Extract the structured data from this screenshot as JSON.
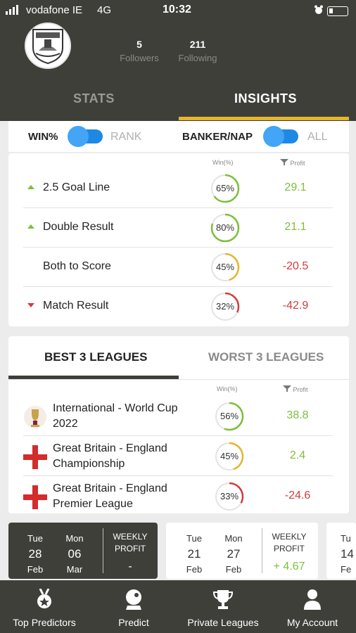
{
  "status_bar": {
    "carrier": "vodafone IE",
    "network": "4G",
    "time": "10:32"
  },
  "profile": {
    "followers_count": "5",
    "followers_label": "Followers",
    "following_count": "211",
    "following_label": "Following"
  },
  "tabs": [
    {
      "label": "STATS"
    },
    {
      "label": "INSIGHTS"
    }
  ],
  "toggles": {
    "win_label": "WIN%",
    "rank_label": "RANK",
    "banker_label": "BANKER/NAP",
    "all_label": "ALL"
  },
  "markets": {
    "col_win": "Win(%)",
    "col_profit": "Profit",
    "rows": [
      {
        "name": "2.5 Goal Line",
        "trend": "up",
        "win_pct": "65%",
        "win_value": 65,
        "profit": "29.1"
      },
      {
        "name": "Double Result",
        "trend": "up",
        "win_pct": "80%",
        "win_value": 80,
        "profit": "21.1"
      },
      {
        "name": "Both to Score",
        "trend": "none",
        "win_pct": "45%",
        "win_value": 45,
        "profit": "-20.5"
      },
      {
        "name": "Match Result",
        "trend": "down",
        "win_pct": "32%",
        "win_value": 32,
        "profit": "-42.9"
      }
    ]
  },
  "leagues": {
    "best_tab": "BEST 3 LEAGUES",
    "worst_tab": "WORST 3 LEAGUES",
    "col_win": "Win(%)",
    "col_profit": "Profit",
    "rows": [
      {
        "name_line1": "International - World Cup",
        "name_line2": "2022",
        "flag": "world-cup-icon",
        "win_pct": "56%",
        "win_value": 56,
        "profit": "38.8"
      },
      {
        "name_line1": "Great Britain - England",
        "name_line2": "Championship",
        "flag": "england-flag-icon",
        "win_pct": "45%",
        "win_value": 45,
        "profit": "2.4"
      },
      {
        "name_line1": "Great Britain - England",
        "name_line2": "Premier League",
        "flag": "england-flag-icon",
        "win_pct": "33%",
        "win_value": 33,
        "profit": "-24.6"
      }
    ]
  },
  "weeks": [
    {
      "day1": "Tue",
      "date1": "28",
      "mon1": "Feb",
      "day2": "Mon",
      "date2": "06",
      "mon2": "Mar",
      "label1": "WEEKLY",
      "label2": "PROFIT",
      "profit": "-"
    },
    {
      "day1": "Tue",
      "date1": "21",
      "mon1": "Feb",
      "day2": "Mon",
      "date2": "27",
      "mon2": "Feb",
      "label1": "WEEKLY",
      "label2": "PROFIT",
      "profit": "+ 4.67"
    },
    {
      "day1": "Tu",
      "date1": "14",
      "mon1": "Fe"
    }
  ],
  "nav": [
    {
      "label": "Top Predictors",
      "icon": "medal-icon"
    },
    {
      "label": "Predict",
      "icon": "crystal-ball-icon"
    },
    {
      "label": "Private Leagues",
      "icon": "trophy-icon"
    },
    {
      "label": "My Account",
      "icon": "person-icon"
    }
  ],
  "colors": {
    "header": "#3f3f3a",
    "accent": "#e5b52b",
    "positive": "#7cbf3a",
    "negative": "#d43b3b",
    "toggle": "#1e88e5"
  }
}
